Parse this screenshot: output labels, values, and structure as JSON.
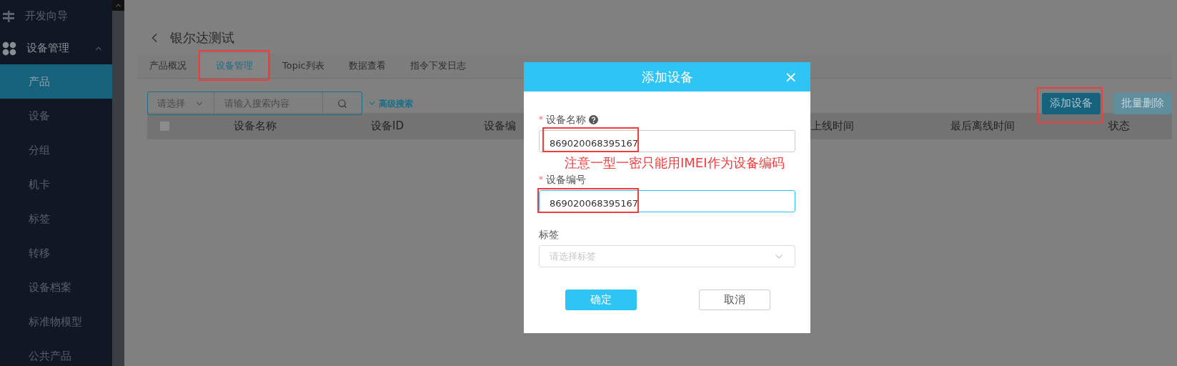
{
  "sidebar": {
    "items": [
      {
        "label": "开发向导",
        "kind": "guide",
        "selected": false
      },
      {
        "label": "设备管理",
        "kind": "group",
        "expanded": true,
        "selected": false,
        "children": [
          {
            "label": "产品",
            "selected": true
          },
          {
            "label": "设备",
            "selected": false
          },
          {
            "label": "分组",
            "selected": false
          },
          {
            "label": "机卡",
            "selected": false
          },
          {
            "label": "标签",
            "selected": false
          },
          {
            "label": "转移",
            "selected": false
          },
          {
            "label": "设备档案",
            "selected": false
          },
          {
            "label": "标准物模型",
            "selected": false
          },
          {
            "label": "公共产品",
            "selected": false
          }
        ]
      }
    ]
  },
  "page": {
    "title": "银尔达测试"
  },
  "tabs": [
    {
      "label": "产品概况",
      "selected": false,
      "highlighted": false
    },
    {
      "label": "设备管理",
      "selected": true,
      "highlighted": true
    },
    {
      "label": "Topic列表",
      "selected": false,
      "highlighted": false
    },
    {
      "label": "数据查看",
      "selected": false,
      "highlighted": false
    },
    {
      "label": "指令下发日志",
      "selected": false,
      "highlighted": false
    }
  ],
  "search": {
    "select_placeholder": "请选择",
    "placeholder": "请输入搜索内容",
    "advanced": "高级搜索"
  },
  "actions": [
    {
      "label": "添加设备",
      "disabled": false,
      "highlighted": true
    },
    {
      "label": "批量删除",
      "disabled": true,
      "highlighted": false
    }
  ],
  "table": {
    "checked": false,
    "columns": [
      "设备名称",
      "设备ID",
      "设备编",
      "上线时间",
      "最后离线时间",
      "状态"
    ]
  },
  "dialog": {
    "title": "添加设备",
    "close": "×",
    "fields": [
      {
        "kind": "input",
        "label": "设备名称",
        "required_mark": "*",
        "help": true,
        "value": "869020068395167",
        "focused": false,
        "highlighted": true
      },
      {
        "kind": "input",
        "label": "设备编号",
        "required_mark": "*",
        "help": false,
        "value": "869020068395167",
        "focused": true,
        "highlighted": true
      },
      {
        "kind": "select",
        "label": "标签",
        "help": false,
        "placeholder": "请选择标签",
        "focused": false,
        "highlighted": false
      }
    ],
    "note": "注意一型一密只能用IMEI作为设备编码",
    "buttons": [
      {
        "label": "确定",
        "kind": "primary"
      },
      {
        "label": "取消",
        "kind": "default"
      }
    ]
  }
}
